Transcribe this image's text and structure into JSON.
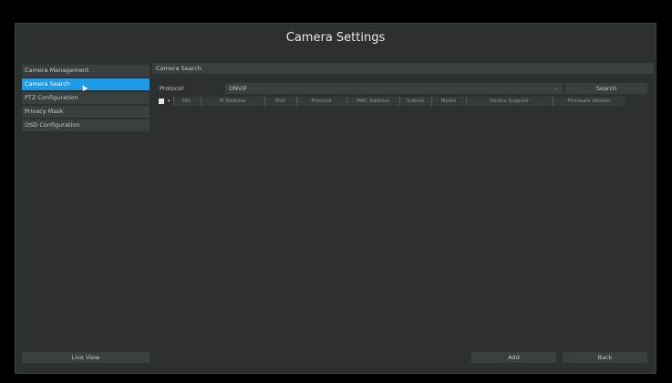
{
  "window": {
    "title": "Camera Settings"
  },
  "sidebar": {
    "items": [
      {
        "label": "Camera Management",
        "active": false
      },
      {
        "label": "Camera Search",
        "active": true
      },
      {
        "label": "PTZ Configuration",
        "active": false
      },
      {
        "label": "Privacy Mask",
        "active": false
      },
      {
        "label": "OSD Configuration",
        "active": false
      }
    ],
    "live_view_label": "Live View"
  },
  "panel": {
    "header": "Camera Search",
    "protocol_label": "Protocol",
    "protocol_value": "ONVIF",
    "search_label": "Search",
    "columns": [
      "NO.",
      "IP Address",
      "Port",
      "Protocol",
      "MAC Address",
      "Subnet",
      "Model",
      "Device Supplier",
      "Firmware Version"
    ]
  },
  "footer": {
    "add_label": "Add",
    "back_label": "Back"
  },
  "colors": {
    "accent": "#1e9be6",
    "background": "#2c3031",
    "control": "#3a3f41"
  }
}
